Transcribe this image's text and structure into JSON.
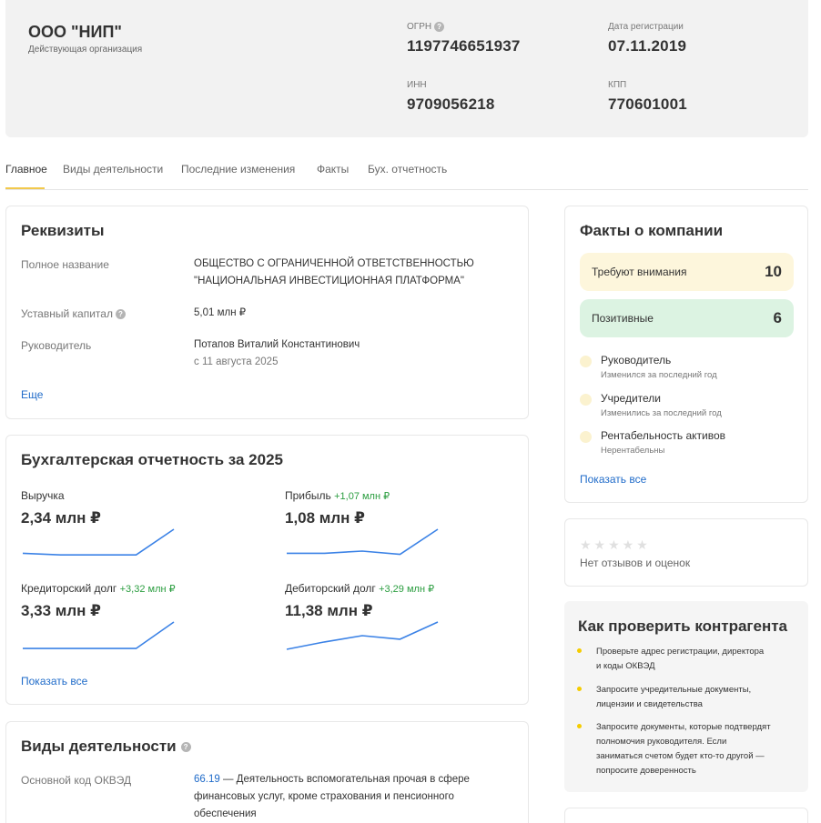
{
  "header": {
    "company_name": "ООО \"НИП\"",
    "status": "Действующая организация",
    "ogrn_label": "ОГРН",
    "ogrn_value": "1197746651937",
    "reg_date_label": "Дата регистрации",
    "reg_date_value": "07.11.2019",
    "inn_label": "ИНН",
    "inn_value": "9709056218",
    "kpp_label": "КПП",
    "kpp_value": "770601001"
  },
  "tabs": [
    {
      "label": "Главное",
      "active": true
    },
    {
      "label": "Виды деятельности",
      "active": false
    },
    {
      "label": "Последние изменения",
      "active": false
    },
    {
      "label": "Факты",
      "active": false
    },
    {
      "label": "Бух. отчетность",
      "active": false
    }
  ],
  "requisites": {
    "title": "Реквизиты",
    "full_name_label": "Полное название",
    "full_name_line1": "ОБЩЕСТВО С ОГРАНИЧЕННОЙ ОТВЕТСТВЕННОСТЬЮ",
    "full_name_line2": "\"НАЦИОНАЛЬНАЯ ИНВЕСТИЦИОННАЯ ПЛАТФОРМА\"",
    "capital_label": "Уставный капитал",
    "capital_value": "5,01 млн ₽",
    "head_label": "Руководитель",
    "head_name": "Потапов Виталий Константинович",
    "head_since": "с 11 августа 2025",
    "more_link": "Еще"
  },
  "finance": {
    "title": "Бухгалтерская отчетность за 2025",
    "show_all": "Показать все",
    "items": [
      {
        "label": "Выручка",
        "delta": "",
        "value": "2,34 млн ₽",
        "trend": [
          0.12,
          0.06,
          0.06,
          0.06,
          1.0
        ]
      },
      {
        "label": "Прибыль",
        "delta": "+1,07 млн ₽",
        "value": "1,08 млн ₽",
        "trend": [
          0.12,
          0.12,
          0.2,
          0.08,
          1.0
        ]
      },
      {
        "label": "Кредиторский долг",
        "delta": "+3,32 млн ₽",
        "value": "3,33 млн ₽",
        "trend": [
          0.03,
          0.03,
          0.03,
          0.03,
          1.0
        ]
      },
      {
        "label": "Дебиторский долг",
        "delta": "+3,29 млн ₽",
        "value": "11,38 млн ₽",
        "trend": [
          0.0,
          0.27,
          0.5,
          0.37,
          1.0
        ]
      }
    ]
  },
  "activities": {
    "title": "Виды деятельности",
    "main_code_label": "Основной код ОКВЭД",
    "main_code": "66.19",
    "main_desc_line1": " — Деятельность вспомогательная прочая в сфере",
    "main_desc_line2": "финансовых услуг, кроме страхования и пенсионного",
    "main_desc_line3": "обеспечения"
  },
  "facts": {
    "title": "Факты о компании",
    "attention_label": "Требуют внимания",
    "attention_count": "10",
    "attention_color": "#fdf6dc",
    "positive_label": "Позитивные",
    "positive_count": "6",
    "positive_color": "#dcf3e2",
    "items": [
      {
        "name": "Руководитель",
        "desc": "Изменился за последний год"
      },
      {
        "name": "Учредители",
        "desc": "Изменились за последний год"
      },
      {
        "name": "Рентабельность активов",
        "desc": "Нерентабельны"
      }
    ],
    "show_all": "Показать все"
  },
  "reviews": {
    "stars": "★★★★★",
    "text": "Нет отзывов и оценок"
  },
  "check": {
    "title": "Как проверить контрагента",
    "items": [
      {
        "line1": "Проверьте адрес регистрации, директора",
        "line2": "и коды ОКВЭД"
      },
      {
        "line1": "Запросите учредительные документы,",
        "line2": "лицензии и свидетельства"
      },
      {
        "line1": "Запросите документы, которые подтвердят",
        "line2": "полномочия руководителя. Если",
        "line3": "заниматься счетом будет кто-то другой —",
        "line4": "попросите доверенность"
      }
    ]
  },
  "colors": {
    "accent_yellow": "#f2c94c",
    "link_blue": "#1f6bc9",
    "positive_green": "#2a9d3f",
    "spark_blue": "#3b82e6"
  }
}
